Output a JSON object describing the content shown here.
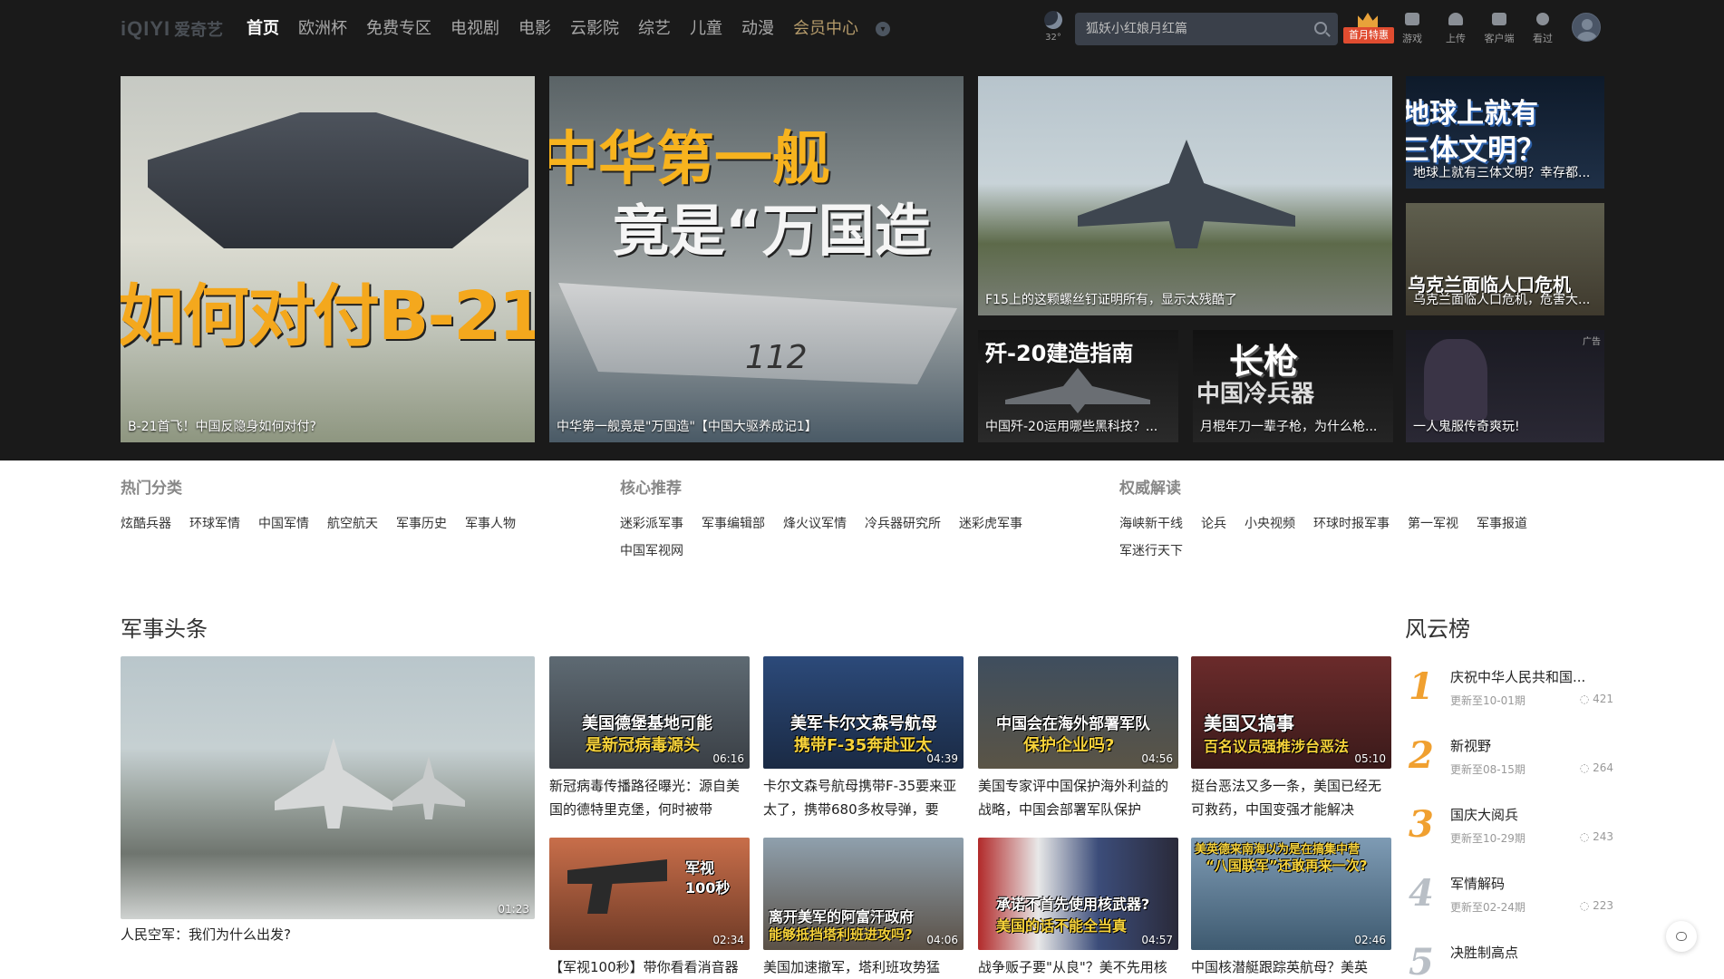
{
  "nav": {
    "logo_en": "iQIYI",
    "logo_cn": "爱奇艺",
    "items": [
      "首页",
      "欧洲杯",
      "免费专区",
      "电视剧",
      "电影",
      "云影院",
      "综艺",
      "儿童",
      "动漫",
      "会员中心"
    ],
    "weather_temp": "32°",
    "search_placeholder": "狐妖小红娘月红篇",
    "promo_label": "首月特惠",
    "tools": [
      "游戏",
      "上传",
      "客户端",
      "看过"
    ]
  },
  "hero": {
    "main_big": "如何对付B-21",
    "main_caption": "B-21首飞！中国反隐身如何对付?",
    "ship_big_1": "中华第一舰",
    "ship_big_2": "竟是“万国造",
    "ship_caption": "中华第一舰竟是\"万国造\"【中国大驱养成记1】",
    "ship_hull": "112",
    "jet_caption": "F15上的这颗螺丝钉证明所有，显示太残酷了",
    "j20_big": "歼-20建造指南",
    "j20_caption": "中国歼-20运用哪些黑科技？...",
    "spear_big_1": "长枪",
    "spear_big_2": "中国冷兵器",
    "spear_caption": "月棍年刀一辈子枪，为什么枪...",
    "side": [
      {
        "big_1": "地球上就有",
        "big_2": "三体文明？",
        "caption": "地球上就有三体文明？幸存都..."
      },
      {
        "big_1": "乌克兰面临人口危机",
        "caption": "乌克兰面临人口危机，危害大..."
      },
      {
        "tag": "广告",
        "caption": "一人鬼服传奇爽玩!"
      }
    ]
  },
  "categories": [
    {
      "title": "热门分类",
      "links": [
        "炫酷兵器",
        "环球军情",
        "中国军情",
        "航空航天",
        "军事历史",
        "军事人物"
      ]
    },
    {
      "title": "核心推荐",
      "links": [
        "迷彩派军事",
        "军事编辑部",
        "烽火议军情",
        "冷兵器研究所",
        "迷彩虎军事",
        "中国军视网"
      ]
    },
    {
      "title": "权威解读",
      "links": [
        "海峡新干线",
        "论兵",
        "小央视频",
        "环球时报军事",
        "第一军视",
        "军事报道",
        "军迷行天下"
      ]
    }
  ],
  "headlines": {
    "title": "军事头条",
    "main": {
      "title": "人民空军：我们为什么出发?",
      "duration": "01:23"
    },
    "cards": [
      {
        "overlay_1": "美国德堡基地可能",
        "overlay_2": "是新冠病毒源头",
        "duration": "06:16",
        "title": "新冠病毒传播路径曝光：源自美国的德特里克堡，何时被带"
      },
      {
        "overlay_1": "美军卡尔文森号航母",
        "overlay_2": "携带F-35奔赴亚太",
        "duration": "04:39",
        "title": "卡尔文森号航母携带F-35要来亚太了，携带680多枚导弹，要"
      },
      {
        "overlay_1": "中国会在海外部署军队",
        "overlay_2": "保护企业吗?",
        "duration": "04:56",
        "title": "美国专家评中国保护海外利益的战略，中国会部署军队保护"
      },
      {
        "overlay_1": "美国又搞事",
        "overlay_2": "百名议员强推涉台恶法",
        "duration": "05:10",
        "title": "挺台恶法又多一条，美国已经无可救药，中国变强才能解决"
      },
      {
        "overlay_1": "军视",
        "overlay_2": "100秒",
        "duration": "02:34",
        "title": "【军视100秒】带你看看消音器"
      },
      {
        "overlay_1": "离开美军的阿富汗政府",
        "overlay_2": "能够抵挡塔利班进攻吗?",
        "duration": "04:06",
        "title": "美国加速撤军，塔利班攻势猛"
      },
      {
        "overlay_1": "承诺不首先使用核武器?",
        "overlay_2": "美国的话不能全当真",
        "duration": "04:57",
        "title": "战争贩子要\"从良\"？美不先用核"
      },
      {
        "overlay_1": "美英德来南海以为是在搞集中营",
        "overlay_2": "“八国联军”还敢再来一次?",
        "duration": "02:46",
        "title": "中国核潜艇跟踪英航母？美英"
      }
    ]
  },
  "rank": {
    "title": "风云榜",
    "items": [
      {
        "num": "1",
        "title": "庆祝中华人民共和国...",
        "update": "更新至10-01期",
        "hot": "421"
      },
      {
        "num": "2",
        "title": "新视野",
        "update": "更新至08-15期",
        "hot": "264"
      },
      {
        "num": "3",
        "title": "国庆大阅兵",
        "update": "更新至10-29期",
        "hot": "243"
      },
      {
        "num": "4",
        "title": "军情解码",
        "update": "更新至02-24期",
        "hot": "223"
      },
      {
        "num": "5",
        "title": "决胜制高点",
        "update": "",
        "hot": ""
      }
    ]
  }
}
